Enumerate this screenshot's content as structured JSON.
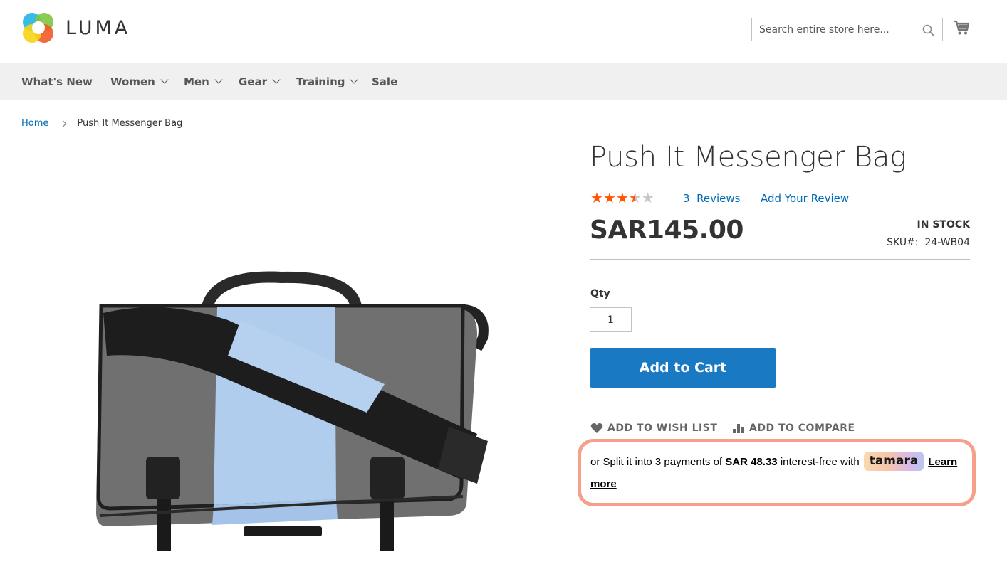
{
  "header": {
    "logo_text": "LUMA",
    "search_placeholder": "Search entire store here..."
  },
  "nav": {
    "items": [
      {
        "label": "What's New",
        "has_dropdown": false
      },
      {
        "label": "Women",
        "has_dropdown": true
      },
      {
        "label": "Men",
        "has_dropdown": true
      },
      {
        "label": "Gear",
        "has_dropdown": true
      },
      {
        "label": "Training",
        "has_dropdown": true
      },
      {
        "label": "Sale",
        "has_dropdown": false
      }
    ]
  },
  "breadcrumb": {
    "home": "Home",
    "current": "Push It Messenger Bag"
  },
  "product": {
    "title": "Push It Messenger Bag",
    "rating_stars": 3.5,
    "rating_max": 5,
    "reviews_count": "3",
    "reviews_label": "Reviews",
    "add_review": "Add Your Review",
    "price": "SAR145.00",
    "stock": "IN STOCK",
    "sku_label": "SKU#:",
    "sku": "24-WB04",
    "qty_label": "Qty",
    "qty_value": "1",
    "add_to_cart": "Add to Cart",
    "wishlist": "ADD TO WISH LIST",
    "compare": "ADD TO COMPARE"
  },
  "tamara": {
    "prefix": "or Split it into 3 payments of",
    "amount": "SAR 48.33",
    "suffix": "interest-free with",
    "badge": "tamara",
    "learn_more": "Learn more"
  },
  "colors": {
    "link": "#006bb4",
    "button": "#1979c3",
    "star_filled": "#ff5501",
    "star_empty": "#c7c7c7",
    "nav_bg": "#f0f0f0",
    "tamara_border": "#f6a08b"
  },
  "icons": {
    "search": "search-icon",
    "cart": "cart-icon",
    "wishlist": "heart-icon",
    "compare": "bar-chart-icon"
  }
}
